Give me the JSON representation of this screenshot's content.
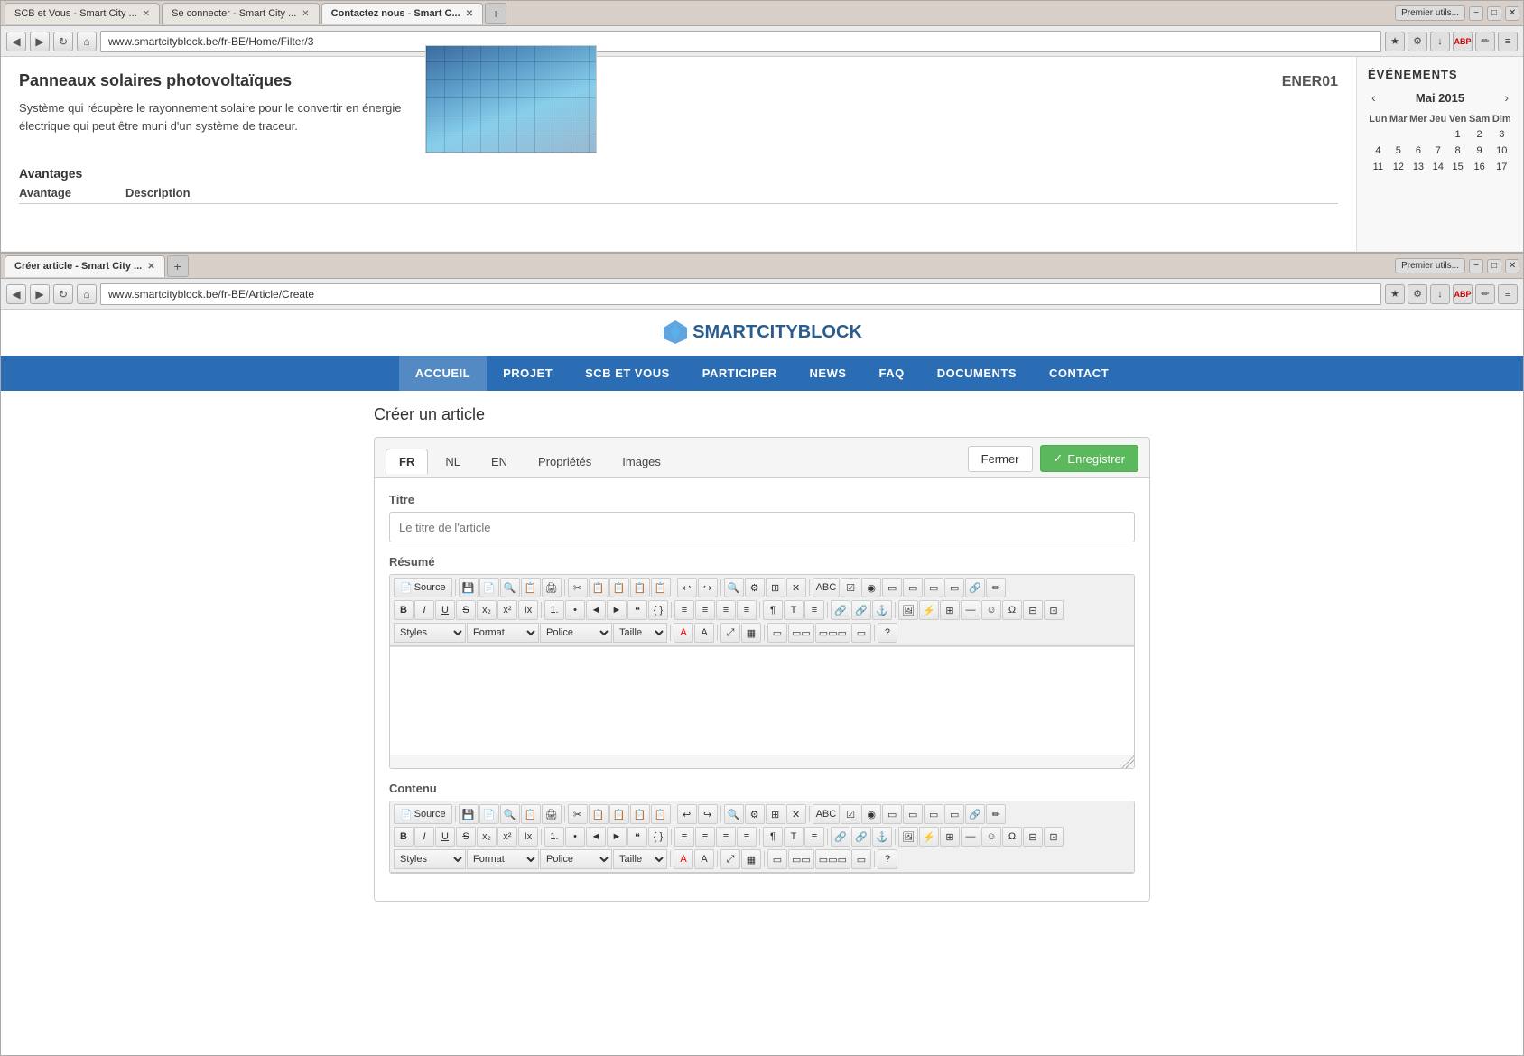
{
  "window1": {
    "tabs": [
      {
        "label": "SCB et Vous - Smart City ...",
        "active": false
      },
      {
        "label": "Se connecter - Smart City ...",
        "active": false
      },
      {
        "label": "Contactez nous - Smart C...",
        "active": true
      }
    ],
    "tab_new_label": "+",
    "top_right": "Premier utils...",
    "addr_url": "www.smartcityblock.be/fr-BE/Home/Filter/3",
    "article": {
      "title": "Panneaux solaires photovoltaïques",
      "code": "ENER01",
      "description": "Système qui récupère le rayonnement solaire pour le convertir en énergie électrique qui peut être muni d'un système de traceur.",
      "avantages_label": "Avantages",
      "avantage_col": "Avantage",
      "description_col": "Description"
    },
    "sidebar": {
      "events_label": "ÉVÉNEMENTS",
      "cal_prev": "‹",
      "cal_next": "›",
      "cal_month": "Mai 2015",
      "cal_days": [
        "Lun",
        "Mar",
        "Mer",
        "Jeu",
        "Ven",
        "Sam",
        "Dim"
      ],
      "cal_week1": [
        "",
        "",
        "",
        "",
        "1",
        "2",
        "3"
      ],
      "cal_week2": [
        "4",
        "5",
        "6",
        "7",
        "8",
        "9",
        "10"
      ],
      "cal_week3": [
        "11",
        "12",
        "13",
        "14",
        "15",
        "16",
        "17"
      ]
    }
  },
  "window2": {
    "tabs": [
      {
        "label": "Créer article - Smart City ...",
        "active": true
      }
    ],
    "top_right": "Premier utils...",
    "addr_url": "www.smartcityblock.be/fr-BE/Article/Create",
    "logo_text": "SMARTCITYBLOCK",
    "nav": {
      "items": [
        {
          "label": "ACCUEIL",
          "active": true
        },
        {
          "label": "PROJET",
          "active": false
        },
        {
          "label": "SCB ET VOUS",
          "active": false
        },
        {
          "label": "PARTICIPER",
          "active": false
        },
        {
          "label": "NEWS",
          "active": false
        },
        {
          "label": "FAQ",
          "active": false
        },
        {
          "label": "DOCUMENTS",
          "active": false
        },
        {
          "label": "CONTACT",
          "active": false
        }
      ]
    },
    "form": {
      "page_title": "Créer un article",
      "tabs": [
        {
          "label": "FR",
          "active": true
        },
        {
          "label": "NL",
          "active": false
        },
        {
          "label": "EN",
          "active": false
        },
        {
          "label": "Propriétés",
          "active": false
        },
        {
          "label": "Images",
          "active": false
        }
      ],
      "btn_close": "Fermer",
      "btn_save": "Enregistrer",
      "titre_label": "Titre",
      "titre_placeholder": "Le titre de l'article",
      "resume_label": "Résumé",
      "contenu_label": "Contenu",
      "rte": {
        "source_btn": "Source",
        "toolbar_row1_icons": [
          "💾",
          "📄",
          "🔍",
          "📋",
          "🖨",
          "✂",
          "📋",
          "📋",
          "📋",
          "📋",
          "↩",
          "↪",
          "🔍",
          "⚙",
          "⊞",
          "⊠",
          "✕",
          "🔗",
          "⊡",
          "⊡",
          "⊡",
          "⊡",
          "🔗",
          "📝"
        ],
        "toolbar_row2_btns": [
          "B",
          "I",
          "U",
          "S",
          "x₂",
          "x²",
          "Ix",
          "1.",
          "•",
          "◄",
          "►",
          "❝",
          "Ω",
          "◄",
          "►",
          "◄",
          "►",
          "¶",
          "T",
          "≡",
          "A",
          "Ω",
          "Ω",
          "◎",
          "Ω"
        ],
        "styles_label": "Styles",
        "format_label": "Format",
        "police_label": "Police",
        "taille_label": "Taille"
      }
    }
  }
}
